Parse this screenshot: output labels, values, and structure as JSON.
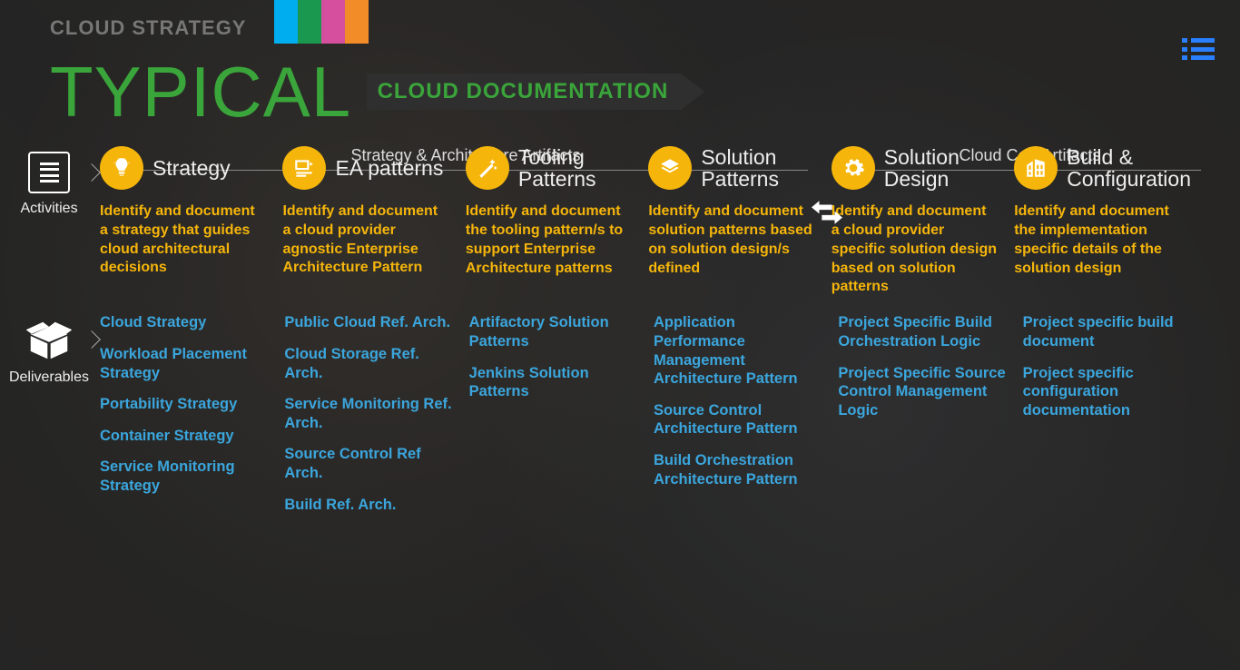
{
  "header": {
    "breadcrumb": "CLOUD STRATEGY",
    "title_big": "TYPICAL",
    "title_sub": "CLOUD DOCUMENTATION"
  },
  "groups": {
    "g1": "Strategy & Architecture Artifacts",
    "g2": "Cloud CoE Artifacts"
  },
  "rows": {
    "activities": "Activities",
    "deliverables": "Deliverables"
  },
  "cols": [
    {
      "title": "Strategy",
      "desc": "Identify and document a strategy that guides cloud architectural decisions",
      "deliv": [
        "Cloud Strategy",
        "Workload Placement Strategy",
        "Portability Strategy",
        "Container Strategy",
        "Service Monitoring Strategy"
      ]
    },
    {
      "title": "EA patterns",
      "desc": "Identify and document a cloud provider agnostic Enterprise Architecture Pattern",
      "deliv": [
        "Public Cloud Ref. Arch.",
        "Cloud Storage Ref. Arch.",
        "Service Monitoring Ref. Arch.",
        "Source Control Ref Arch.",
        "Build Ref. Arch."
      ]
    },
    {
      "title": "Tooling Patterns",
      "desc": "Identify and document the tooling pattern/s to support Enterprise Architecture patterns",
      "deliv": [
        "Artifactory Solution Patterns",
        "Jenkins Solution Patterns"
      ]
    },
    {
      "title": "Solution Patterns",
      "desc": "Identify and document solution patterns based on solution design/s defined",
      "deliv": [
        "Application Performance Management Architecture Pattern",
        "Source Control Architecture Pattern",
        "Build Orchestration Architecture Pattern"
      ]
    },
    {
      "title": "Solution Design",
      "desc": "Identify and document a cloud provider specific solution design based on solution patterns",
      "deliv": [
        "Project Specific Build Orchestration Logic",
        "Project Specific Source Control Management Logic"
      ]
    },
    {
      "title": "Build & Configuration",
      "desc": "Identify and document the implementation specific details of the solution design",
      "deliv": [
        "Project specific build document",
        "Project specific configuration documentation"
      ]
    }
  ]
}
